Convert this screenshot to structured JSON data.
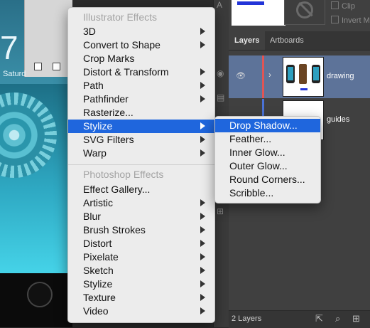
{
  "artwork": {
    "clock": "7",
    "day": "Saturd"
  },
  "clip_options": [
    "Clip",
    "Invert M"
  ],
  "tabs": [
    "Layers",
    "Artboards"
  ],
  "layers": [
    {
      "name": "drawing",
      "color": "#e05555",
      "selected": true
    },
    {
      "name": "guides",
      "color": "#4a72d6",
      "selected": false
    }
  ],
  "footer": {
    "count": "2 Layers"
  },
  "menu": {
    "illustrator_header": "Illustrator Effects",
    "illustrator_items": [
      {
        "label": "3D",
        "submenu": true
      },
      {
        "label": "Convert to Shape",
        "submenu": true
      },
      {
        "label": "Crop Marks",
        "submenu": false
      },
      {
        "label": "Distort & Transform",
        "submenu": true
      },
      {
        "label": "Path",
        "submenu": true
      },
      {
        "label": "Pathfinder",
        "submenu": true
      },
      {
        "label": "Rasterize...",
        "submenu": false
      },
      {
        "label": "Stylize",
        "submenu": true,
        "highlighted": true
      },
      {
        "label": "SVG Filters",
        "submenu": true
      },
      {
        "label": "Warp",
        "submenu": true
      }
    ],
    "photoshop_header": "Photoshop Effects",
    "photoshop_items": [
      {
        "label": "Effect Gallery...",
        "submenu": false
      },
      {
        "label": "Artistic",
        "submenu": true
      },
      {
        "label": "Blur",
        "submenu": true
      },
      {
        "label": "Brush Strokes",
        "submenu": true
      },
      {
        "label": "Distort",
        "submenu": true
      },
      {
        "label": "Pixelate",
        "submenu": true
      },
      {
        "label": "Sketch",
        "submenu": true
      },
      {
        "label": "Stylize",
        "submenu": true
      },
      {
        "label": "Texture",
        "submenu": true
      },
      {
        "label": "Video",
        "submenu": true
      }
    ]
  },
  "submenu": {
    "items": [
      {
        "label": "Drop Shadow...",
        "highlighted": true
      },
      {
        "label": "Feather..."
      },
      {
        "label": "Inner Glow..."
      },
      {
        "label": "Outer Glow..."
      },
      {
        "label": "Round Corners..."
      },
      {
        "label": "Scribble..."
      }
    ]
  },
  "colors": {
    "highlight": "#1f66dd",
    "menu_bg": "#ececec",
    "selected_layer": "#5d7399"
  }
}
